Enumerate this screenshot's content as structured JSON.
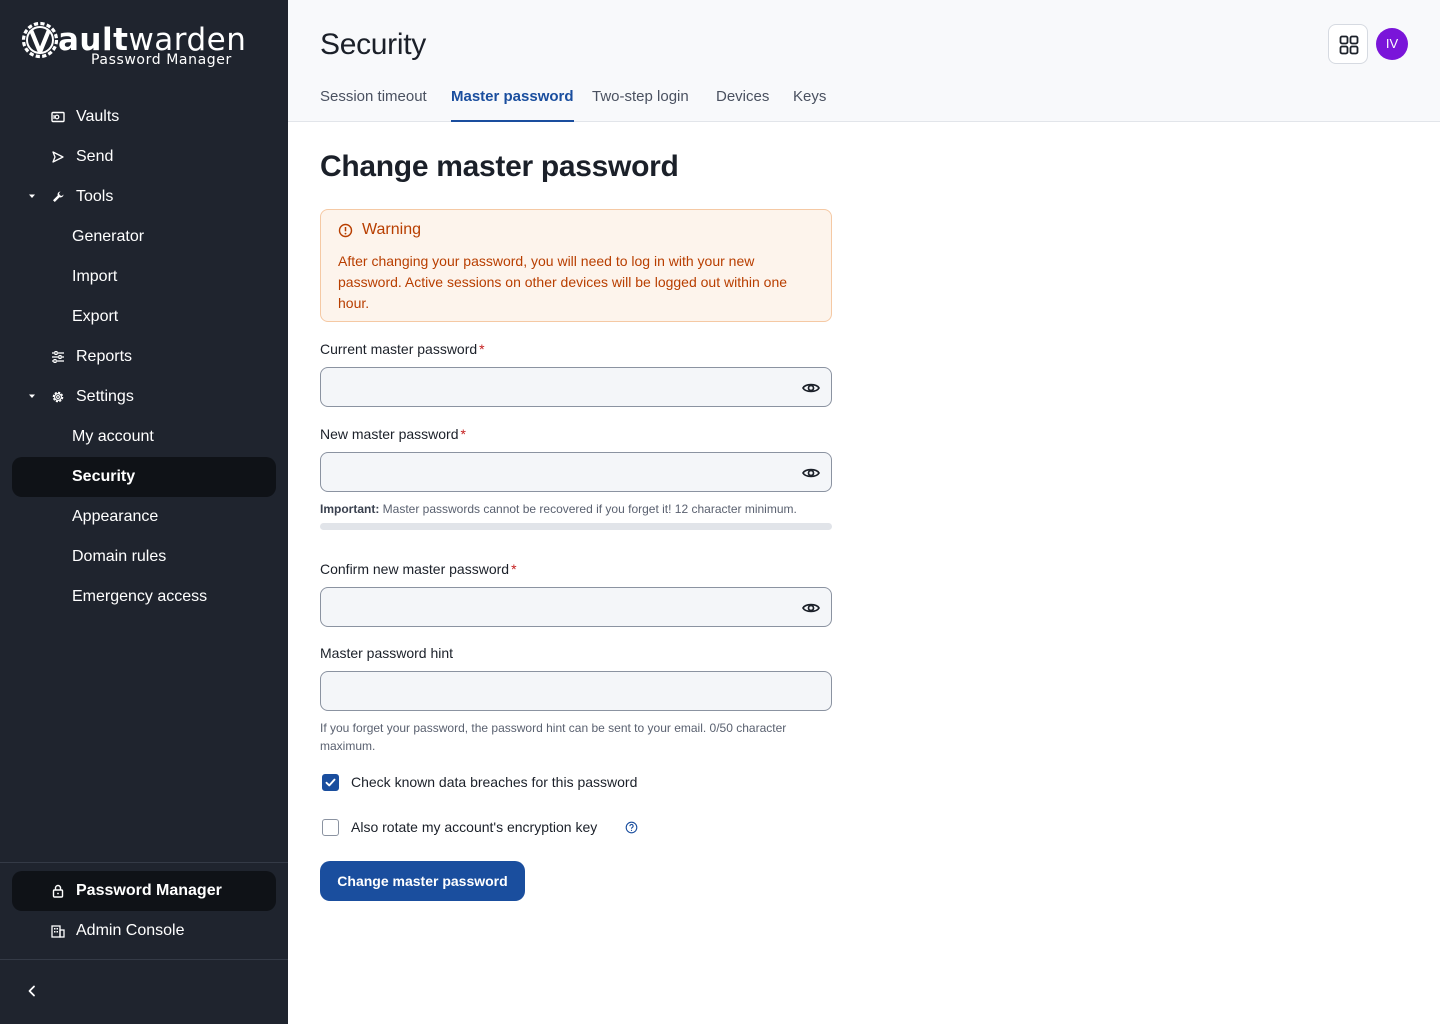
{
  "brand": {
    "logo_letter": "V",
    "name_rest": "ault",
    "name_tail": "warden",
    "subtitle": "Password Manager"
  },
  "sidebar": {
    "items": [
      {
        "label": "Vaults",
        "icon": "vault-icon"
      },
      {
        "label": "Send",
        "icon": "send-icon"
      },
      {
        "label": "Tools",
        "icon": "wrench-icon",
        "expanded": true
      },
      {
        "label": "Generator"
      },
      {
        "label": "Import"
      },
      {
        "label": "Export"
      },
      {
        "label": "Reports",
        "icon": "reports-icon"
      },
      {
        "label": "Settings",
        "icon": "gear-icon",
        "expanded": true
      },
      {
        "label": "My account"
      },
      {
        "label": "Security",
        "active": true
      },
      {
        "label": "Appearance"
      },
      {
        "label": "Domain rules"
      },
      {
        "label": "Emergency access"
      }
    ],
    "products": [
      {
        "label": "Password Manager",
        "icon": "lock-icon",
        "active": true
      },
      {
        "label": "Admin Console",
        "icon": "building-icon"
      }
    ],
    "collapse_icon": "chevron-left-icon"
  },
  "header": {
    "title": "Security",
    "avatar_initials": "IV",
    "avatar_color": "#7a15d9",
    "tabs": [
      {
        "label": "Session timeout"
      },
      {
        "label": "Master password",
        "active": true
      },
      {
        "label": "Two-step login"
      },
      {
        "label": "Devices"
      },
      {
        "label": "Keys"
      }
    ]
  },
  "main": {
    "title": "Change master password",
    "warning": {
      "title": "Warning",
      "body": "After changing your password, you will need to log in with your new password. Active sessions on other devices will be logged out within one hour."
    },
    "fields": {
      "current": {
        "label": "Current master password",
        "required": "*",
        "value": ""
      },
      "new": {
        "label": "New master password",
        "required": "*",
        "value": ""
      },
      "new_hint_bold": "Important:",
      "new_hint": " Master passwords cannot be recovered if you forget it! 12 character minimum.",
      "confirm": {
        "label": "Confirm new master password",
        "required": "*",
        "value": ""
      },
      "hint": {
        "label": "Master password hint",
        "value": ""
      },
      "hint_help": "If you forget your password, the password hint can be sent to your email. 0/50 character maximum."
    },
    "checkboxes": {
      "breach": {
        "label": "Check known data breaches for this password",
        "checked": true
      },
      "rotate": {
        "label": "Also rotate my account's encryption key",
        "checked": false
      }
    },
    "submit_label": "Change master password"
  },
  "colors": {
    "sidebar_bg": "#1f242e",
    "accent": "#1a4e9e",
    "warning_text": "#b83e00",
    "warning_bg": "#fdf4ec"
  }
}
